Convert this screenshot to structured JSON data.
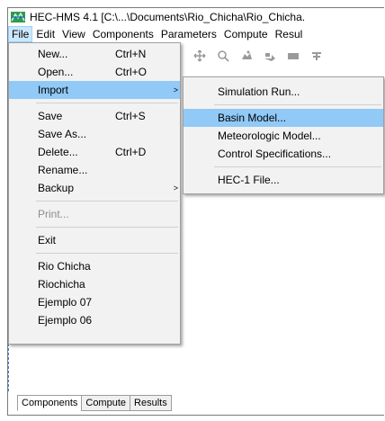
{
  "window": {
    "title": "HEC-HMS 4.1 [C:\\...\\Documents\\Rio_Chicha\\Rio_Chicha.",
    "icon": "hec-hms-app-icon"
  },
  "menubar": {
    "items": [
      "File",
      "Edit",
      "View",
      "Components",
      "Parameters",
      "Compute",
      "Resul"
    ]
  },
  "toolbar": {
    "icons": [
      "move-icon",
      "zoom-icon",
      "add-subbasin-icon",
      "add-reach-icon",
      "add-reservoir-icon",
      "add-junction-icon"
    ]
  },
  "file_menu": {
    "new": {
      "label": "New...",
      "shortcut": "Ctrl+N"
    },
    "open": {
      "label": "Open...",
      "shortcut": "Ctrl+O"
    },
    "import": {
      "label": "Import",
      "arrow": ">"
    },
    "save": {
      "label": "Save",
      "shortcut": "Ctrl+S"
    },
    "save_as": {
      "label": "Save As..."
    },
    "delete": {
      "label": "Delete...",
      "shortcut": "Ctrl+D"
    },
    "rename": {
      "label": "Rename..."
    },
    "backup": {
      "label": "Backup",
      "arrow": ">"
    },
    "print": {
      "label": "Print..."
    },
    "exit": {
      "label": "Exit"
    },
    "recent": [
      "Rio Chicha",
      "Riochicha",
      "Ejemplo 07",
      "Ejemplo 06"
    ]
  },
  "import_submenu": {
    "items": [
      "Simulation Run...",
      "Basin Model...",
      "Meteorologic Model...",
      "Control Specifications...",
      "HEC-1 File..."
    ]
  },
  "bottom_tabs": [
    "Components",
    "Compute",
    "Results"
  ],
  "colors": {
    "highlight": "#91c9f7",
    "menu_bg": "#f2f2f2",
    "menubar_active": "#cce8ff"
  }
}
